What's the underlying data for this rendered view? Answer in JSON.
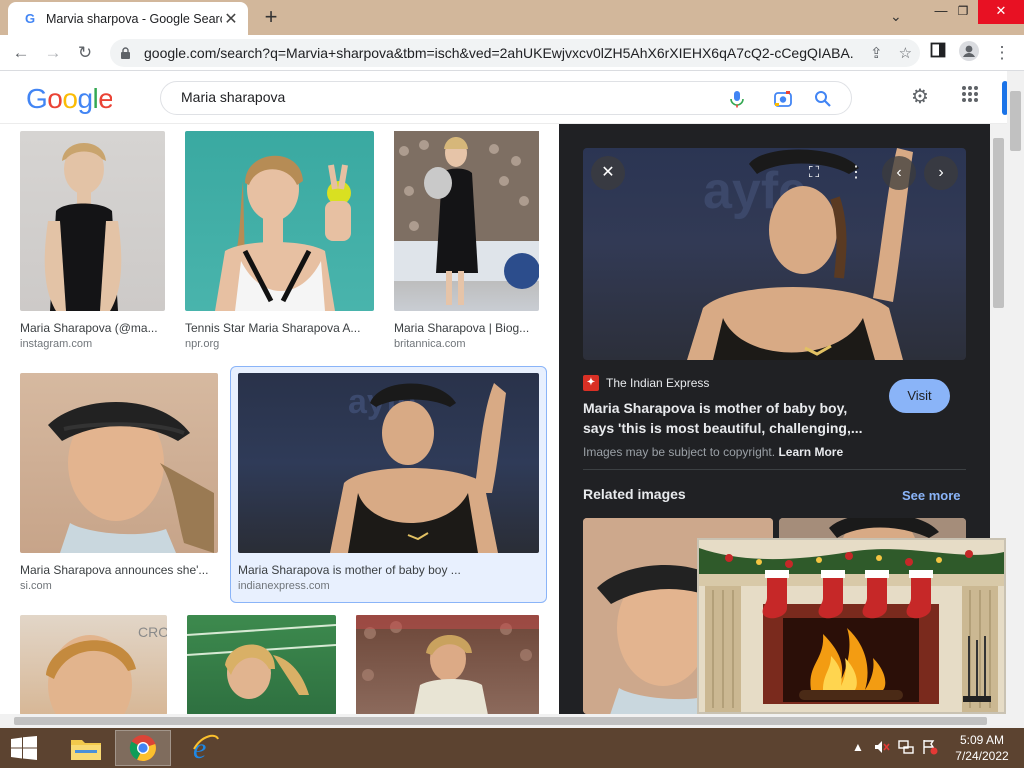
{
  "browser": {
    "tab_title": "Marvia sharpova - Google Search",
    "tab_favicon": "G",
    "url": "google.com/search?q=Marvia+sharpova&tbm=isch&ved=2ahUKEwjvxcv0lZH5AhX6rXIEHX6qA7cQ2-cCegQIABA..."
  },
  "google": {
    "logo": "Google",
    "query": "Maria sharapova"
  },
  "results": [
    {
      "caption": "Maria Sharapova (@ma...",
      "source": "instagram.com"
    },
    {
      "caption": "Tennis Star Maria Sharapova A...",
      "source": "npr.org"
    },
    {
      "caption": "Maria Sharapova | Biog...",
      "source": "britannica.com"
    },
    {
      "caption": "Maria Sharapova announces she'...",
      "source": "si.com"
    },
    {
      "caption": "Maria Sharapova is mother of baby boy ...",
      "source": "indianexpress.com"
    }
  ],
  "preview": {
    "source_name": "The Indian Express",
    "title": "Maria Sharapova is mother of baby boy, says 'this is most beautiful, challenging,...",
    "visit_label": "Visit",
    "copyright_text": "Images may be subject to copyright.",
    "learn_more": "Learn More",
    "related_heading": "Related images",
    "see_more": "See more"
  },
  "taskbar": {
    "time": "5:09 AM",
    "date": "7/24/2022"
  },
  "colors": {
    "accent": "#1a73e8",
    "panel_bg": "#202124",
    "visit_button": "#8ab4f8",
    "titlebar": "#d2b79b",
    "taskbar": "#5c4330"
  }
}
